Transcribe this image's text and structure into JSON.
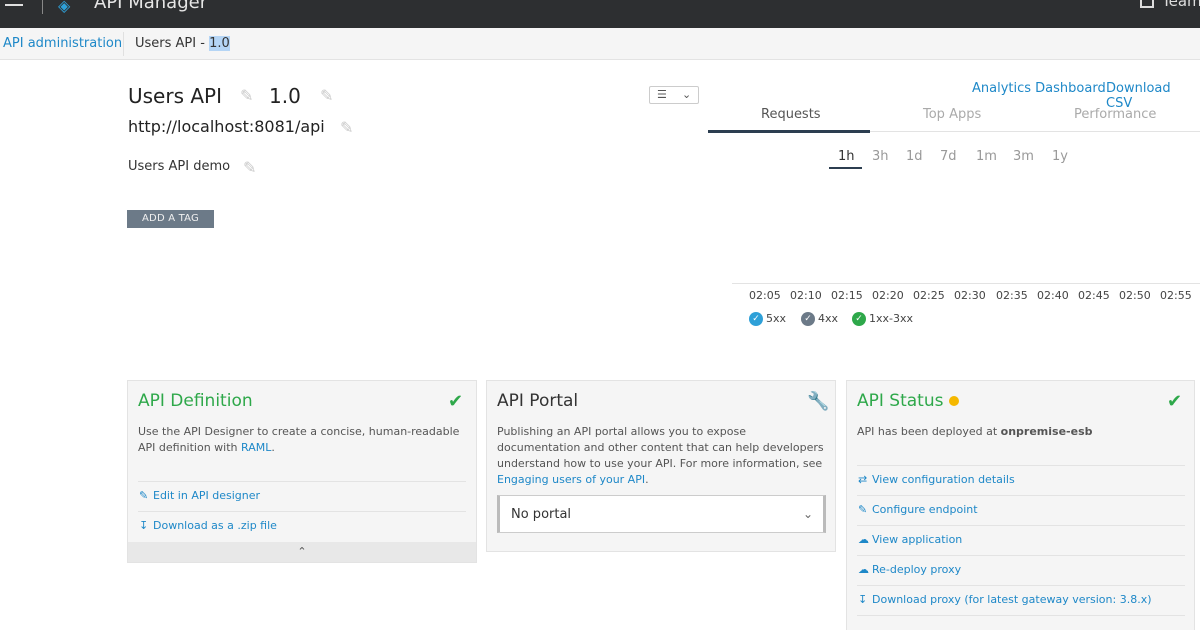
{
  "topbar": {
    "app_title": "API Manager",
    "team_label": "Team"
  },
  "breadcrumb": {
    "root": "API administration",
    "current_prefix": "Users API - ",
    "current_version": "1.0"
  },
  "api": {
    "name": "Users API",
    "version": "1.0",
    "url": "http://localhost:8081/api",
    "description": "Users API demo",
    "add_tag_label": "ADD A TAG"
  },
  "analytics": {
    "dashboard_link": "Analytics Dashboard",
    "download_link": "Download CSV",
    "tabs": [
      "Requests",
      "Top Apps",
      "Performance"
    ],
    "active_tab": "Requests",
    "ranges": [
      "1h",
      "3h",
      "1d",
      "7d",
      "1m",
      "3m",
      "1y"
    ],
    "active_range": "1h",
    "time_ticks": [
      "02:05",
      "02:10",
      "02:15",
      "02:20",
      "02:25",
      "02:30",
      "02:35",
      "02:40",
      "02:45",
      "02:50",
      "02:55"
    ],
    "legend": [
      {
        "label": "5xx",
        "color": "#2ea0d8"
      },
      {
        "label": "4xx",
        "color": "#6c7a88"
      },
      {
        "label": "1xx-3xx",
        "color": "#2ea84a"
      }
    ]
  },
  "cards": {
    "definition": {
      "title": "API Definition",
      "text_before": "Use the API Designer to create a concise, human-readable API definition with ",
      "text_link": "RAML",
      "text_after": ".",
      "edit_link": "Edit in API designer",
      "download_link": "Download as a .zip file"
    },
    "portal": {
      "title": "API Portal",
      "text_before": "Publishing an API portal allows you to expose documentation and other content that can help developers understand how to use your API. For more information, see ",
      "text_link": "Engaging users of your API",
      "text_after": ".",
      "select_value": "No portal"
    },
    "status": {
      "title": "API Status",
      "deployed_prefix": "API has been deployed at ",
      "deployed_target": "onpremise-esb",
      "links": [
        "View configuration details",
        "Configure endpoint",
        "View application",
        "Re-deploy proxy",
        "Download proxy (for latest gateway version: 3.8.x)"
      ]
    }
  },
  "colors": {
    "accent": "#1e88c8",
    "success": "#2ea84a",
    "warning": "#f5b800",
    "topbar": "#2d2f31"
  }
}
